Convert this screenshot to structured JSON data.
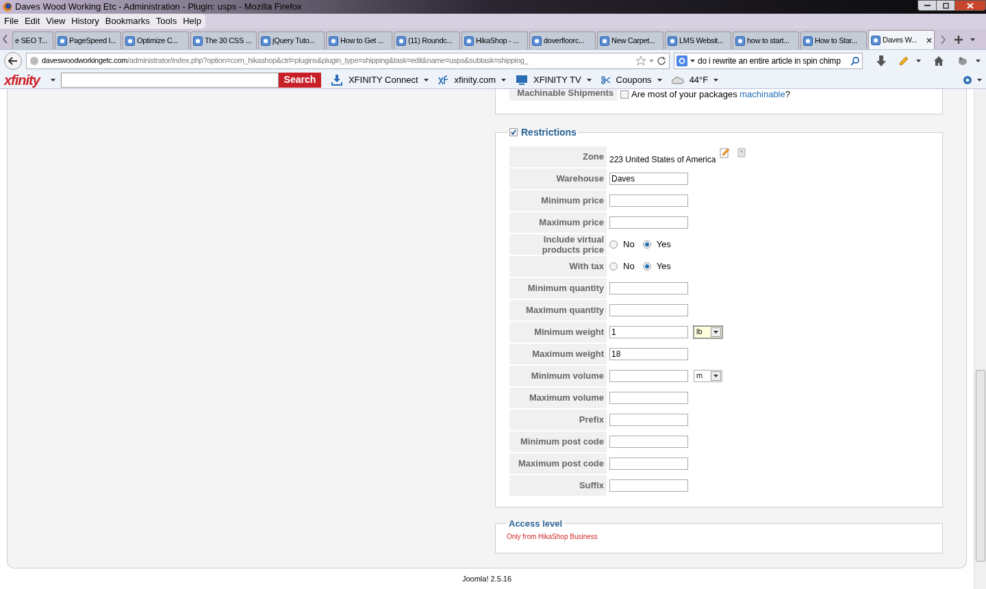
{
  "window": {
    "title": "Daves Wood Working Etc - Administration - Plugin: usps - Mozilla Firefox"
  },
  "menu_bar": [
    "File",
    "Edit",
    "View",
    "History",
    "Bookmarks",
    "Tools",
    "Help"
  ],
  "tabs": [
    {
      "label": "e SEO T...",
      "selected": false
    },
    {
      "label": "PageSpeed I...",
      "selected": false
    },
    {
      "label": "Optimize C...",
      "selected": false
    },
    {
      "label": "The 30 CSS ...",
      "selected": false
    },
    {
      "label": "jQuery Tuto...",
      "selected": false
    },
    {
      "label": "How to Get ...",
      "selected": false
    },
    {
      "label": "(11) Roundc...",
      "selected": false
    },
    {
      "label": "HikaShop - ...",
      "selected": false
    },
    {
      "label": "doverfloorc...",
      "selected": false
    },
    {
      "label": "New Carpet...",
      "selected": false
    },
    {
      "label": "LMS Websit...",
      "selected": false
    },
    {
      "label": "how to start...",
      "selected": false
    },
    {
      "label": "How to Star...",
      "selected": false
    },
    {
      "label": "Daves W...",
      "selected": true
    }
  ],
  "address_bar": {
    "host": "daveswoodworkingetc.com",
    "path": "/administrator/index.php?option=com_hikashop&ctrl=plugins&plugin_type=shipping&task=edit&name=usps&subtask=shipping_"
  },
  "search_bar": {
    "value": "do i rewrite an entire article in spin chimp"
  },
  "xfinity_toolbar": {
    "logo": "xfinity",
    "search_button": "Search",
    "items": [
      {
        "kind": "download",
        "label": "XFINITY Connect"
      },
      {
        "kind": "xf",
        "label": "xfinity.com"
      },
      {
        "kind": "tv",
        "label": "XFINITY TV"
      },
      {
        "kind": "scissors",
        "label": "Coupons"
      },
      {
        "kind": "weather",
        "label": "44°F"
      }
    ]
  },
  "machinable": {
    "label": "Machinable Shipments",
    "checked": false,
    "text_before": "Are most of your packages ",
    "link": "machinable",
    "text_after": "?"
  },
  "restrictions": {
    "title": "Restrictions",
    "checked": true,
    "fields": [
      {
        "kind": "zone",
        "label": "Zone",
        "value": "223 United States of America"
      },
      {
        "kind": "text",
        "label": "Warehouse",
        "value": "Daves"
      },
      {
        "kind": "text",
        "label": "Minimum price"
      },
      {
        "kind": "text",
        "label": "Maximum price"
      },
      {
        "kind": "radio",
        "label": "Include virtual products price",
        "options": [
          {
            "label": "No",
            "selected": false
          },
          {
            "label": "Yes",
            "selected": true
          }
        ]
      },
      {
        "kind": "radio",
        "label": "With tax",
        "options": [
          {
            "label": "No",
            "selected": false
          },
          {
            "label": "Yes",
            "selected": true
          }
        ]
      },
      {
        "kind": "text",
        "label": "Minimum quantity"
      },
      {
        "kind": "text",
        "label": "Maximum quantity"
      },
      {
        "kind": "unit",
        "label": "Minimum weight",
        "value": "1",
        "unit": "lb",
        "focused": true
      },
      {
        "kind": "text",
        "label": "Maximum weight",
        "value": "18"
      },
      {
        "kind": "unit",
        "label": "Minimum volume",
        "unit": "m",
        "focused": false
      },
      {
        "kind": "text",
        "label": "Maximum volume"
      },
      {
        "kind": "text",
        "label": "Prefix"
      },
      {
        "kind": "text",
        "label": "Minimum post code"
      },
      {
        "kind": "text",
        "label": "Maximum post code"
      },
      {
        "kind": "text",
        "label": "Suffix"
      }
    ]
  },
  "access_level": {
    "title": "Access level",
    "note": "Only from HikaShop Business"
  },
  "footer": "Joomla! 2.5.16"
}
